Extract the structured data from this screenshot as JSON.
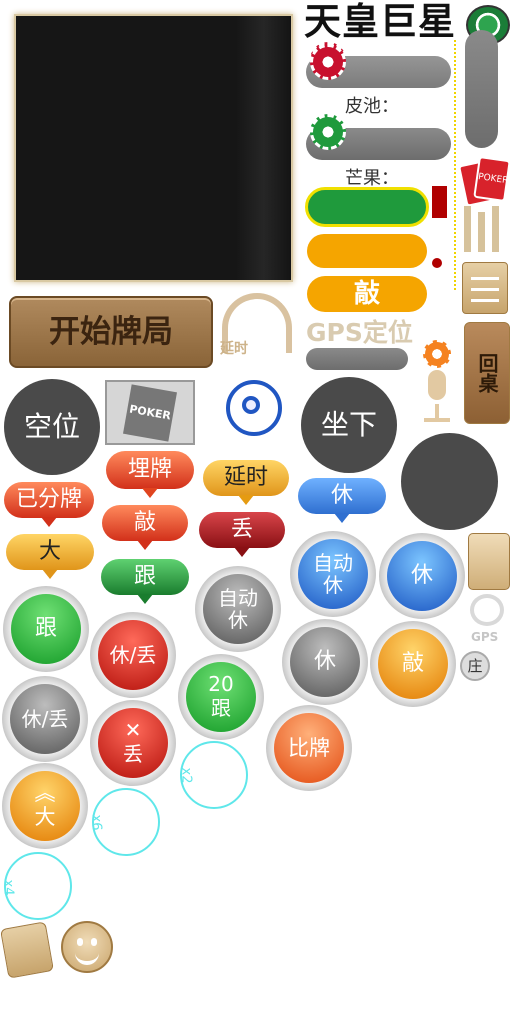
{
  "title": "天皇巨星",
  "labels": {
    "pot": "皮池：",
    "mango": "芒果：",
    "knock_yellow": "敲",
    "gps_location": "GPS定位",
    "delay_small": "延时",
    "start_game": "开始牌局",
    "back_table": "回桌",
    "empty_seat": "空位",
    "sit_down": "坐下",
    "poker": "POKER",
    "gps_small": "GPS",
    "dealer": "庄"
  },
  "bubbles": {
    "bury": "埋牌",
    "delay": "延时",
    "rest_blue": "休",
    "dealt": "已分牌",
    "knock": "敲",
    "discard": "丢",
    "big": "大",
    "follow": "跟"
  },
  "balls": {
    "follow_green": "跟",
    "rest_discard_red": "休/丢",
    "auto_rest_gray": "自动休",
    "auto_rest_blue": "自动休",
    "rest_blue": "休",
    "rest_gray": "休",
    "knock_orange": "敲",
    "rest_discard_gray": "休/丢",
    "discard_red_x": "✕",
    "discard_red": "丢",
    "follow_20_num": "20",
    "follow_20": "跟",
    "compare": "比牌",
    "big_orange_arrow": "︽",
    "big_orange": "大"
  },
  "multipliers": [
    "x2",
    "x6",
    "x4"
  ],
  "colors": {
    "green": "#1f9a3c",
    "orange": "#f5a500",
    "red_stop": "#b00000",
    "gray": "#4a4a4a",
    "tan": "#c9a46a",
    "cyan": "#5fe7ea"
  }
}
